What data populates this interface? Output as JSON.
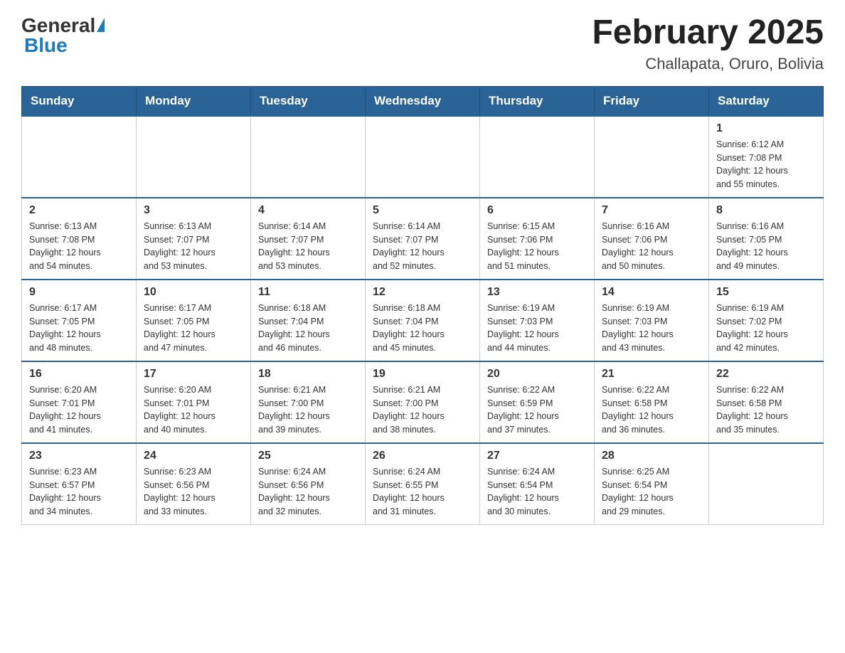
{
  "logo": {
    "general": "General",
    "blue": "Blue",
    "tagline": ""
  },
  "title": "February 2025",
  "subtitle": "Challapata, Oruro, Bolivia",
  "days_of_week": [
    "Sunday",
    "Monday",
    "Tuesday",
    "Wednesday",
    "Thursday",
    "Friday",
    "Saturday"
  ],
  "weeks": [
    {
      "days": [
        {
          "number": "",
          "info": ""
        },
        {
          "number": "",
          "info": ""
        },
        {
          "number": "",
          "info": ""
        },
        {
          "number": "",
          "info": ""
        },
        {
          "number": "",
          "info": ""
        },
        {
          "number": "",
          "info": ""
        },
        {
          "number": "1",
          "info": "Sunrise: 6:12 AM\nSunset: 7:08 PM\nDaylight: 12 hours\nand 55 minutes."
        }
      ]
    },
    {
      "days": [
        {
          "number": "2",
          "info": "Sunrise: 6:13 AM\nSunset: 7:08 PM\nDaylight: 12 hours\nand 54 minutes."
        },
        {
          "number": "3",
          "info": "Sunrise: 6:13 AM\nSunset: 7:07 PM\nDaylight: 12 hours\nand 53 minutes."
        },
        {
          "number": "4",
          "info": "Sunrise: 6:14 AM\nSunset: 7:07 PM\nDaylight: 12 hours\nand 53 minutes."
        },
        {
          "number": "5",
          "info": "Sunrise: 6:14 AM\nSunset: 7:07 PM\nDaylight: 12 hours\nand 52 minutes."
        },
        {
          "number": "6",
          "info": "Sunrise: 6:15 AM\nSunset: 7:06 PM\nDaylight: 12 hours\nand 51 minutes."
        },
        {
          "number": "7",
          "info": "Sunrise: 6:16 AM\nSunset: 7:06 PM\nDaylight: 12 hours\nand 50 minutes."
        },
        {
          "number": "8",
          "info": "Sunrise: 6:16 AM\nSunset: 7:05 PM\nDaylight: 12 hours\nand 49 minutes."
        }
      ]
    },
    {
      "days": [
        {
          "number": "9",
          "info": "Sunrise: 6:17 AM\nSunset: 7:05 PM\nDaylight: 12 hours\nand 48 minutes."
        },
        {
          "number": "10",
          "info": "Sunrise: 6:17 AM\nSunset: 7:05 PM\nDaylight: 12 hours\nand 47 minutes."
        },
        {
          "number": "11",
          "info": "Sunrise: 6:18 AM\nSunset: 7:04 PM\nDaylight: 12 hours\nand 46 minutes."
        },
        {
          "number": "12",
          "info": "Sunrise: 6:18 AM\nSunset: 7:04 PM\nDaylight: 12 hours\nand 45 minutes."
        },
        {
          "number": "13",
          "info": "Sunrise: 6:19 AM\nSunset: 7:03 PM\nDaylight: 12 hours\nand 44 minutes."
        },
        {
          "number": "14",
          "info": "Sunrise: 6:19 AM\nSunset: 7:03 PM\nDaylight: 12 hours\nand 43 minutes."
        },
        {
          "number": "15",
          "info": "Sunrise: 6:19 AM\nSunset: 7:02 PM\nDaylight: 12 hours\nand 42 minutes."
        }
      ]
    },
    {
      "days": [
        {
          "number": "16",
          "info": "Sunrise: 6:20 AM\nSunset: 7:01 PM\nDaylight: 12 hours\nand 41 minutes."
        },
        {
          "number": "17",
          "info": "Sunrise: 6:20 AM\nSunset: 7:01 PM\nDaylight: 12 hours\nand 40 minutes."
        },
        {
          "number": "18",
          "info": "Sunrise: 6:21 AM\nSunset: 7:00 PM\nDaylight: 12 hours\nand 39 minutes."
        },
        {
          "number": "19",
          "info": "Sunrise: 6:21 AM\nSunset: 7:00 PM\nDaylight: 12 hours\nand 38 minutes."
        },
        {
          "number": "20",
          "info": "Sunrise: 6:22 AM\nSunset: 6:59 PM\nDaylight: 12 hours\nand 37 minutes."
        },
        {
          "number": "21",
          "info": "Sunrise: 6:22 AM\nSunset: 6:58 PM\nDaylight: 12 hours\nand 36 minutes."
        },
        {
          "number": "22",
          "info": "Sunrise: 6:22 AM\nSunset: 6:58 PM\nDaylight: 12 hours\nand 35 minutes."
        }
      ]
    },
    {
      "days": [
        {
          "number": "23",
          "info": "Sunrise: 6:23 AM\nSunset: 6:57 PM\nDaylight: 12 hours\nand 34 minutes."
        },
        {
          "number": "24",
          "info": "Sunrise: 6:23 AM\nSunset: 6:56 PM\nDaylight: 12 hours\nand 33 minutes."
        },
        {
          "number": "25",
          "info": "Sunrise: 6:24 AM\nSunset: 6:56 PM\nDaylight: 12 hours\nand 32 minutes."
        },
        {
          "number": "26",
          "info": "Sunrise: 6:24 AM\nSunset: 6:55 PM\nDaylight: 12 hours\nand 31 minutes."
        },
        {
          "number": "27",
          "info": "Sunrise: 6:24 AM\nSunset: 6:54 PM\nDaylight: 12 hours\nand 30 minutes."
        },
        {
          "number": "28",
          "info": "Sunrise: 6:25 AM\nSunset: 6:54 PM\nDaylight: 12 hours\nand 29 minutes."
        },
        {
          "number": "",
          "info": ""
        }
      ]
    }
  ]
}
